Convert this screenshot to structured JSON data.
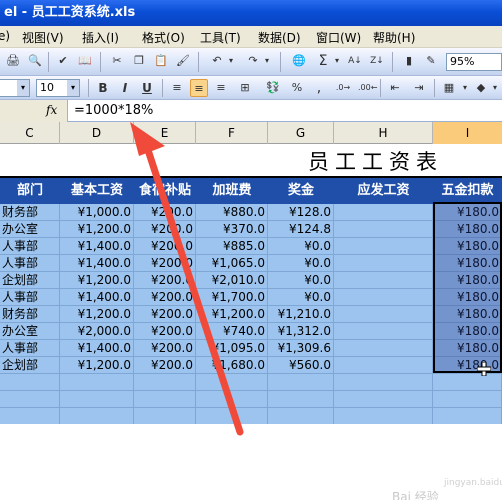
{
  "window": {
    "title": "el - 员工工资系统.xls"
  },
  "menu": [
    {
      "label": "e)"
    },
    {
      "label": "视图(V)"
    },
    {
      "label": "插入(I)"
    },
    {
      "label": "格式(O)"
    },
    {
      "label": "工具(T)"
    },
    {
      "label": "数据(D)"
    },
    {
      "label": "窗口(W)"
    },
    {
      "label": "帮助(H)"
    }
  ],
  "toolbar": {
    "zoom": "95%",
    "font_size": "10",
    "bold_icon": "B",
    "italic_icon": "I",
    "underline_icon": "U",
    "percent_icon": "%"
  },
  "formula_bar": {
    "fx_label": "fx",
    "formula": "=1000*18%"
  },
  "columns": {
    "c": "C",
    "d": "D",
    "e": "E",
    "f": "F",
    "g": "G",
    "h": "H",
    "i": "I"
  },
  "sheet": {
    "title": "员工工资表",
    "headers": [
      "部门",
      "基本工资",
      "食宿补贴",
      "加班费",
      "奖金",
      "应发工资",
      "五金扣款"
    ],
    "rows": [
      [
        "财务部",
        "¥1,000.0",
        "¥200.0",
        "¥880.0",
        "¥128.0",
        "",
        "¥180.0"
      ],
      [
        "办公室",
        "¥1,200.0",
        "¥200.0",
        "¥370.0",
        "¥124.8",
        "",
        "¥180.0"
      ],
      [
        "人事部",
        "¥1,400.0",
        "¥200.0",
        "¥885.0",
        "¥0.0",
        "",
        "¥180.0"
      ],
      [
        "人事部",
        "¥1,400.0",
        "¥200.0",
        "¥1,065.0",
        "¥0.0",
        "",
        "¥180.0"
      ],
      [
        "企划部",
        "¥1,200.0",
        "¥200.0",
        "¥2,010.0",
        "¥0.0",
        "",
        "¥180.0"
      ],
      [
        "人事部",
        "¥1,400.0",
        "¥200.0",
        "¥1,700.0",
        "¥0.0",
        "",
        "¥180.0"
      ],
      [
        "财务部",
        "¥1,200.0",
        "¥200.0",
        "¥1,200.0",
        "¥1,210.0",
        "",
        "¥180.0"
      ],
      [
        "办公室",
        "¥2,000.0",
        "¥200.0",
        "¥740.0",
        "¥1,312.0",
        "",
        "¥180.0"
      ],
      [
        "人事部",
        "¥1,400.0",
        "¥200.0",
        "¥1,095.0",
        "¥1,309.6",
        "",
        "¥180.0"
      ],
      [
        "企划部",
        "¥1,200.0",
        "¥200.0",
        "¥1,680.0",
        "¥560.0",
        "",
        "¥180.0"
      ]
    ]
  },
  "colors": {
    "header_bg": "#1f4fa8",
    "body_bg": "#9cc4ef",
    "arrow": "#f04a3a"
  },
  "watermark": {
    "text": "Bai 经验",
    "site": "jingyan.baidu.com"
  }
}
